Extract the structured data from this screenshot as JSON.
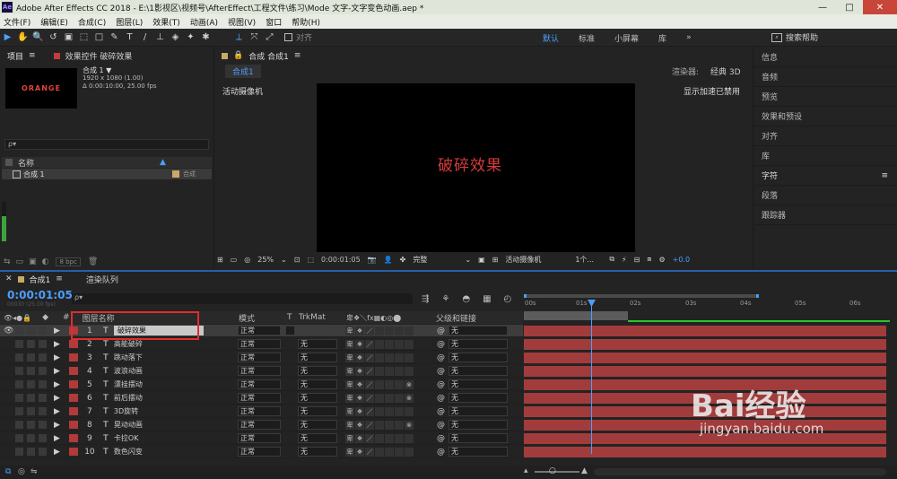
{
  "window": {
    "title": "Adobe After Effects CC 2018 - E:\\1影视区\\视频号\\AfterEffect\\工程文件\\练习\\Mode 文字-文字变色动画.aep *",
    "controls": [
      "—",
      "□",
      "✕"
    ]
  },
  "menu": [
    "文件(F)",
    "编辑(E)",
    "合成(C)",
    "图层(L)",
    "效果(T)",
    "动画(A)",
    "视图(V)",
    "窗口",
    "帮助(H)"
  ],
  "toolbar": {
    "tools": [
      "▶",
      "✋",
      "🔍",
      "↺",
      "▣",
      "⬚",
      "□",
      "✎",
      "T",
      "/",
      "⊥",
      "◈",
      "✦",
      "✱"
    ],
    "snap_label": "对齐"
  },
  "workspace": {
    "items": [
      "默认",
      "标准",
      "小屏幕",
      "库"
    ],
    "active": "默认",
    "more": "»",
    "search_placeholder": "搜索帮助"
  },
  "project": {
    "tab": "项目",
    "effects_tab": "效果控件 破碎效果",
    "thumb_text": "ORANGE",
    "comp_name": "合成 1 ▼",
    "comp_size": "1920 x 1080 (1.00)",
    "comp_duration": "Δ 0:00:10:00, 25.00 fps",
    "col_name": "名称",
    "row_name": "合成 1",
    "row_type": "合成",
    "bpc": "8 bpc"
  },
  "composition": {
    "tab_label": "合成 合成1",
    "sub_tab": "合成1",
    "renderer_label": "渲染器:",
    "renderer_value": "经典 3D",
    "camera": "活动摄像机",
    "accel": "显示加速已禁用",
    "canvas_text": "破碎效果",
    "footer": {
      "zoom": "25%",
      "time": "0:00:01:05",
      "resolution": "完整",
      "view": "活动摄像机",
      "views_count": "1个...",
      "exposure": "+0.0"
    }
  },
  "right_panel": {
    "items": [
      "信息",
      "音频",
      "预览",
      "效果和预设",
      "对齐",
      "库",
      "字符",
      "段落",
      "跟踪器"
    ]
  },
  "timeline": {
    "tab": "合成1",
    "render_queue": "渲染队列",
    "timecode": "0:00:01:05",
    "timecode_sub": "00030 (25.00 fps)",
    "search_placeholder": "ρ▾",
    "headers": {
      "hash": "#",
      "layer_name": "图层名称",
      "mode": "模式",
      "t": "T",
      "trkmat": "TrkMat",
      "parent": "父级和链接"
    },
    "ticks": [
      "00s",
      "01s",
      "02s",
      "03s",
      "04s",
      "05s",
      "06s"
    ],
    "layers": [
      {
        "num": "1",
        "name": "破碎效果",
        "mode": "正常",
        "trkmat": "",
        "parent": "无"
      },
      {
        "num": "2",
        "name": "高能破碎",
        "mode": "正常",
        "trkmat": "无",
        "parent": "无"
      },
      {
        "num": "3",
        "name": "跳动落下",
        "mode": "正常",
        "trkmat": "无",
        "parent": "无"
      },
      {
        "num": "4",
        "name": "波浪动画",
        "mode": "正常",
        "trkmat": "无",
        "parent": "无"
      },
      {
        "num": "5",
        "name": "漂挂摆动",
        "mode": "正常",
        "trkmat": "无",
        "parent": "无"
      },
      {
        "num": "6",
        "name": "前后摆动",
        "mode": "正常",
        "trkmat": "无",
        "parent": "无"
      },
      {
        "num": "7",
        "name": "3D旋转",
        "mode": "正常",
        "trkmat": "无",
        "parent": "无"
      },
      {
        "num": "8",
        "name": "晃动动画",
        "mode": "正常",
        "trkmat": "无",
        "parent": "无"
      },
      {
        "num": "9",
        "name": "卡拉OK",
        "mode": "正常",
        "trkmat": "无",
        "parent": "无"
      },
      {
        "num": "10",
        "name": "数色闪变",
        "mode": "正常",
        "trkmat": "无",
        "parent": "无"
      }
    ]
  },
  "watermark": {
    "brand": "Bai经验",
    "url": "jingyan.baidu.com"
  }
}
